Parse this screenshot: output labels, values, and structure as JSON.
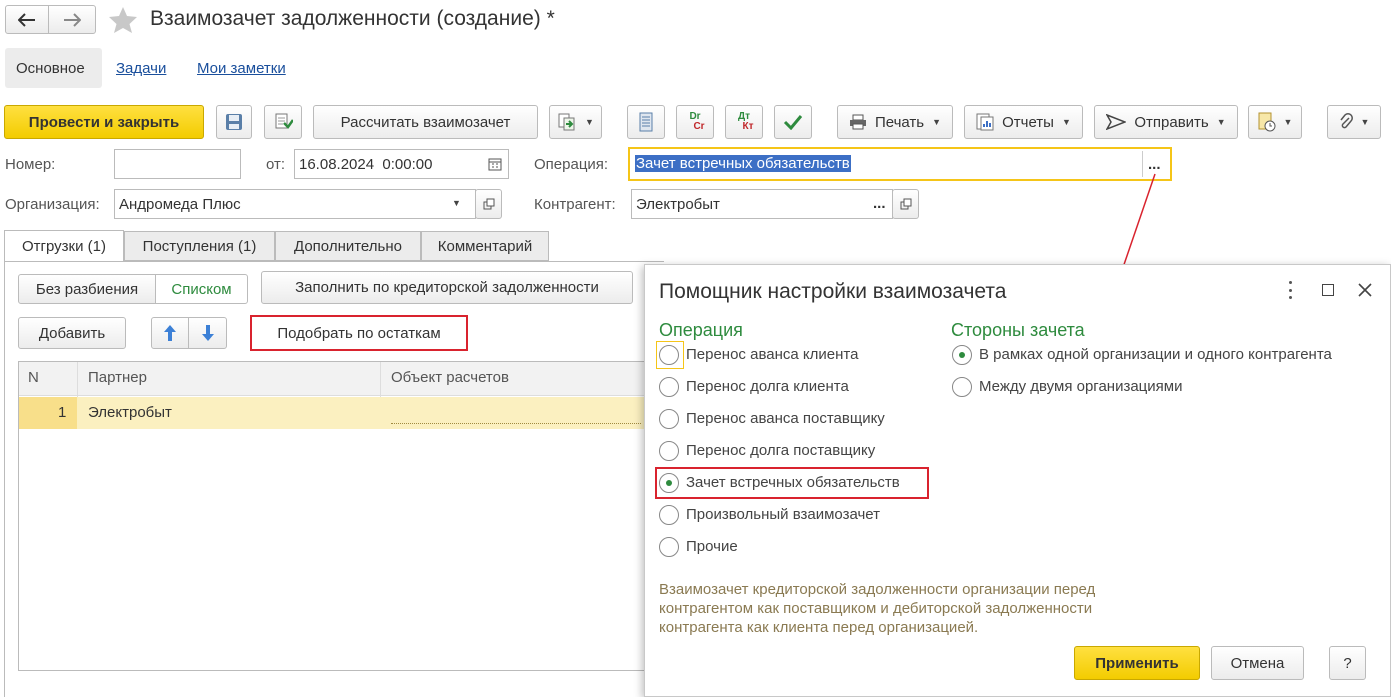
{
  "window": {
    "title": "Взаимозачет задолженности (создание) *"
  },
  "nav_tabs": [
    "Основное",
    "Задачи",
    "Мои заметки"
  ],
  "toolbar": {
    "post_close": "Провести и закрыть",
    "calc": "Рассчитать взаимозачет",
    "print": "Печать",
    "reports": "Отчеты",
    "send": "Отправить",
    "dr_top": "Dr",
    "dr_bottom": "Cr",
    "dt_top": "Дт",
    "dt_bottom": "Кт"
  },
  "form": {
    "number_label": "Номер:",
    "number_value": "",
    "date_label": "от:",
    "date_value": "16.08.2024  0:00:00",
    "operation_label": "Операция:",
    "operation_value": "Зачет встречных обязательств",
    "org_label": "Организация:",
    "org_value": "Андромеда Плюс",
    "contractor_label": "Контрагент:",
    "contractor_value": "Электробыт",
    "ellipsis": "...",
    "ellipsis2": "..."
  },
  "doc_tabs": [
    "Отгрузки (1)",
    "Поступления (1)",
    "Дополнительно",
    "Комментарий"
  ],
  "panel": {
    "no_split": "Без разбиения",
    "as_list": "Списком",
    "fill_credit": "Заполнить по кредиторской задолженности",
    "add": "Добавить",
    "pick_balances": "Подобрать по остаткам"
  },
  "table": {
    "columns": [
      "N",
      "Партнер",
      "Объект расчетов"
    ],
    "rows": [
      {
        "n": "1",
        "partner": "Электробыт",
        "object": ""
      }
    ]
  },
  "dialog": {
    "title": "Помощник настройки взаимозачета",
    "operation_header": "Операция",
    "operations": [
      {
        "label": "Перенос аванса клиента",
        "selected": false
      },
      {
        "label": "Перенос долга клиента",
        "selected": false
      },
      {
        "label": "Перенос аванса поставщику",
        "selected": false
      },
      {
        "label": "Перенос долга поставщику",
        "selected": false
      },
      {
        "label": "Зачет встречных обязательств",
        "selected": true
      },
      {
        "label": "Произвольный взаимозачет",
        "selected": false
      },
      {
        "label": "Прочие",
        "selected": false
      }
    ],
    "sides_header": "Стороны зачета",
    "sides": [
      {
        "label": "В рамках одной организации и одного контрагента",
        "selected": true
      },
      {
        "label": "Между двумя организациями",
        "selected": false
      }
    ],
    "description": [
      "Взаимозачет кредиторской задолженности организации перед",
      "контрагентом как поставщиком и дебиторской задолженности",
      "контрагента как клиента перед организацией."
    ],
    "apply": "Применить",
    "cancel": "Отмена",
    "help": "?"
  },
  "colors": {
    "accent_yellow": "#f5d40f",
    "green_header": "#2e8b3e",
    "red_highlight": "#d9232e",
    "selection_blue": "#3c6fc5"
  }
}
